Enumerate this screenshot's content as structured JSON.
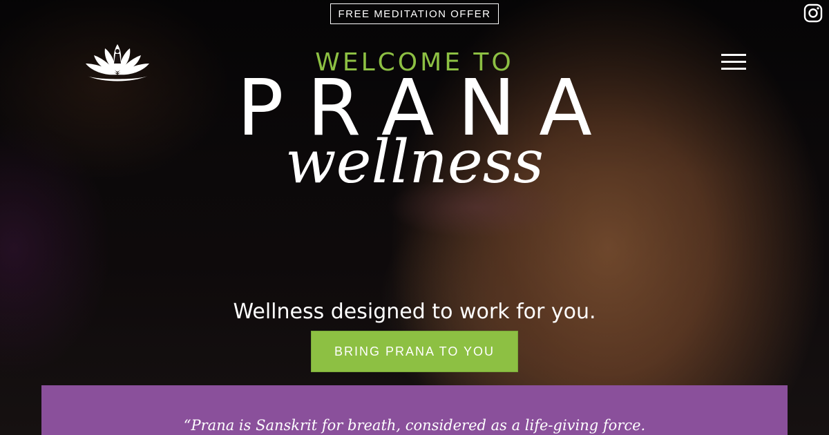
{
  "top_bar": {
    "offer_label": "FREE MEDITATION OFFER",
    "instagram_icon": "instagram-icon"
  },
  "header": {
    "logo_icon": "lotus-logo-icon",
    "menu_icon": "hamburger-menu-icon"
  },
  "hero": {
    "welcome": "WELCOME TO",
    "brand_main": "PRANA",
    "brand_sub": "wellness",
    "tagline": "Wellness designed to work for you.",
    "cta_label": "BRING PRANA TO YOU"
  },
  "quote_section": {
    "text": "“Prana is Sanskrit for breath, considered as a life-giving force."
  },
  "colors": {
    "accent_green": "#8dc043",
    "panel_purple": "#8a509b",
    "text": "#ffffff"
  }
}
